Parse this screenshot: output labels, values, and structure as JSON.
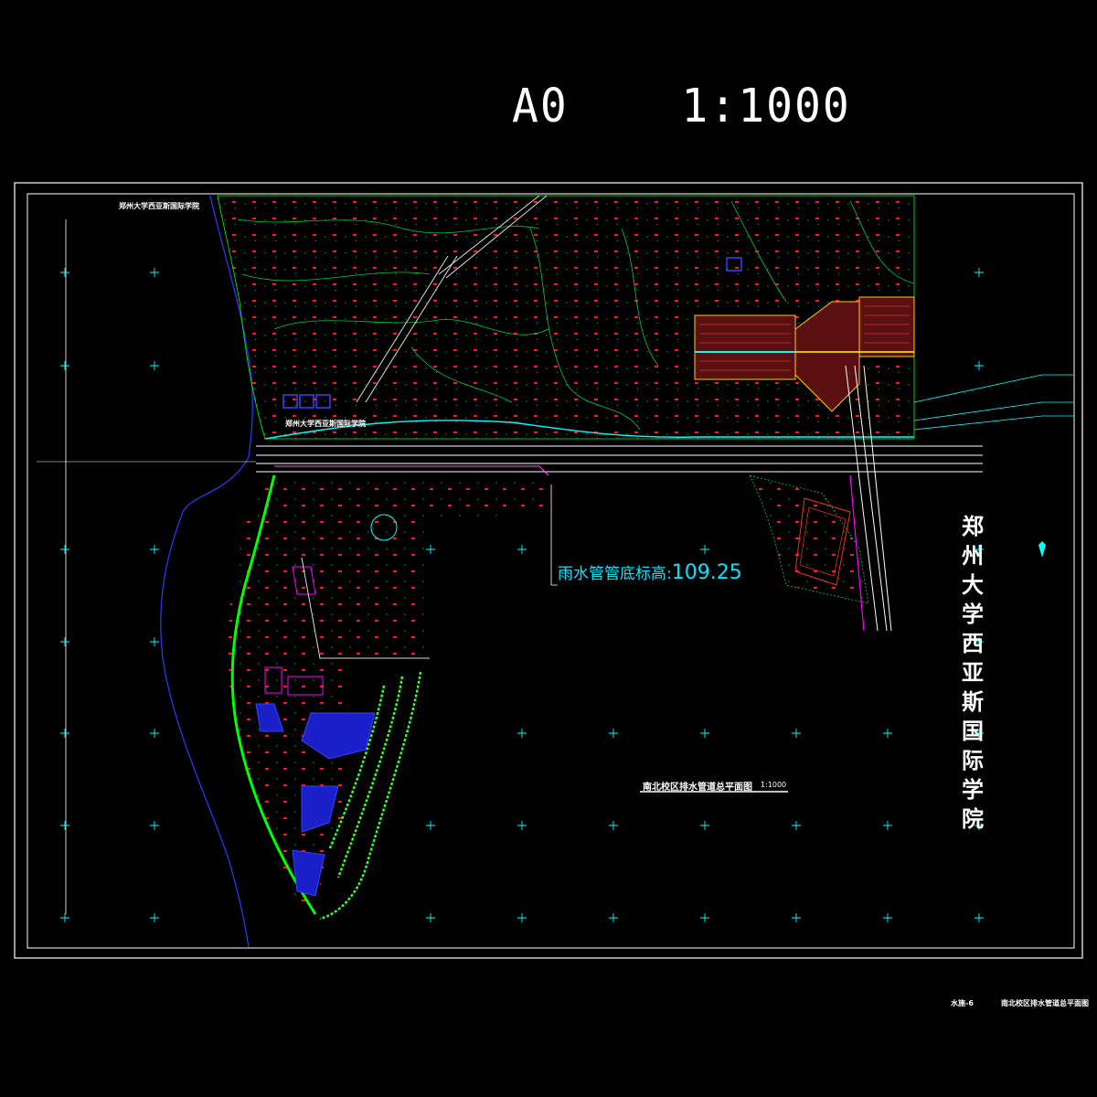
{
  "sheet": {
    "title": "A0    1:1000",
    "school_name": "郑州大学西亚斯国际学院",
    "rain_pipe_label": "雨水管管底标高:",
    "rain_pipe_value": "109.25",
    "plan_title": "南北校区排水管道总平面图",
    "plan_scale": "1:1000",
    "top_left_label": "郑州大学西亚斯国际学院",
    "road_label": "郑州大学西亚斯国际学院",
    "footer_sheet_no": "水施-6",
    "footer_title": "南北校区排水管道总平面图"
  },
  "colors": {
    "background": "#000000",
    "frame": "#ffffff",
    "terrain": "#00ff00",
    "elevation": "#ff0000",
    "pipe": "#00ffff",
    "building": "#0000ff",
    "road": "#ffffff",
    "magenta": "#ff00ff",
    "yellow": "#ffff00"
  },
  "icons": [
    "grid-cross-icon",
    "tree-symbol-icon",
    "manhole-icon"
  ]
}
